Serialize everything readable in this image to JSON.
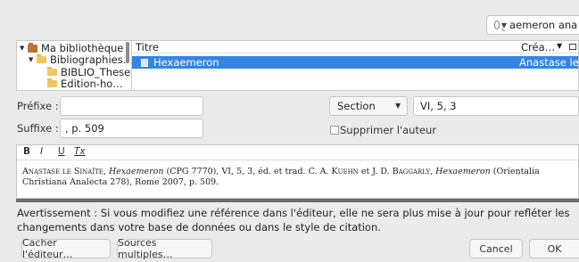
{
  "search": {
    "value": "aemeron ana"
  },
  "library_tree": {
    "items": [
      {
        "label": "Ma bibliothèque",
        "icon": "library-icon",
        "expanded": true
      },
      {
        "label": "Bibliographies…",
        "icon": "folder-icon",
        "expanded": true
      },
      {
        "label": "BIBLIO_These",
        "icon": "folder-icon"
      },
      {
        "label": "Edition-ho…",
        "icon": "folder-icon"
      }
    ]
  },
  "items_list": {
    "columns": {
      "title": "Titre",
      "creator": "Créa…"
    },
    "rows": [
      {
        "title": "Hexaemeron",
        "creator": "Anastase le …",
        "selected": true
      }
    ]
  },
  "form": {
    "prefix_label": "Préfixe :",
    "prefix_value": "",
    "suffix_label": "Suffixe :",
    "suffix_value": ", p. 509",
    "locator_type": "Section",
    "locator_value": "VI, 5, 3",
    "suppress_author_label": "Supprimer l'auteur",
    "suppress_author_checked": false
  },
  "editor": {
    "toolbar": {
      "bold": "B",
      "italic": "I",
      "underline": "U",
      "clear_format": "Tx"
    },
    "text": {
      "author": "Anastase le Sinaïte",
      "title": "Hexaemeron",
      "middle": "(CPG 7770), VI, 5, 3, éd. et trad. C. A. ",
      "editor1": "Kuehn",
      "and": " et J. D. ",
      "editor2": "Baggarly",
      "title2": "Hexaemeron",
      "series": "(Orientalia Christiana Analecta 278), Rome 2007, p. 509."
    }
  },
  "warning": "Avertissement : Si vous modifiez une référence dans l'éditeur, elle ne sera plus mise à jour pour refléter les changements dans votre base de données ou dans le style de citation.",
  "buttons": {
    "hide_editor": "Cacher l'éditeur…",
    "multiple_sources": "Sources multiples…",
    "cancel": "Cancel",
    "ok": "OK"
  },
  "colors": {
    "selection": "#3584e4",
    "background": "#ebebeb"
  }
}
